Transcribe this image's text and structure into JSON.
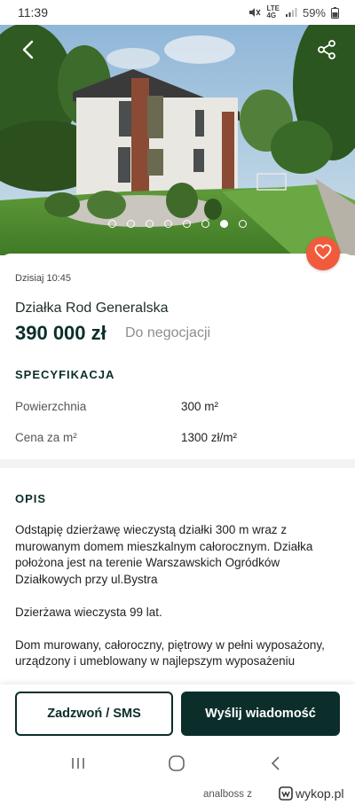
{
  "status_bar": {
    "time": "11:39",
    "network": "LTE",
    "network_sub": "4G",
    "battery": "59%",
    "icons": [
      "mute-icon",
      "signal-icon",
      "battery-icon"
    ]
  },
  "gallery": {
    "photo_count": 8,
    "active_index": 6,
    "icons": [
      "back-arrow-icon",
      "share-icon"
    ]
  },
  "listing": {
    "date": "Dzisiaj 10:45",
    "title": "Działka Rod Generalska",
    "price": "390 000 zł",
    "negotiable": "Do negocjacji",
    "favorite_icon": "heart-icon"
  },
  "specs": {
    "heading": "SPECYFIKACJA",
    "rows": [
      {
        "label": "Powierzchnia",
        "value": "300 m²"
      },
      {
        "label": "Cena za m²",
        "value": "1300 zł/m²"
      }
    ]
  },
  "description": {
    "heading": "OPIS",
    "paragraphs": [
      "Odstąpię dzierżawę wieczystą działki 300 m wraz z murowanym domem mieszkalnym całorocznym. Działka położona jest na terenie Warszawskich Ogródków Działkowych przy ul.Bystra",
      "Dzierżawa wieczysta 99 lat.",
      "Dom murowany, całoroczny, piętrowy w pełni wyposażony, urządzony i umeblowany w najlepszym wyposażeniu"
    ]
  },
  "actions": {
    "call_label": "Zadzwoń / SMS",
    "message_label": "Wyślij wiadomość"
  },
  "navigation": {
    "icons": [
      "recent-apps-icon",
      "home-icon",
      "back-icon"
    ]
  },
  "watermark": {
    "user": "analboss",
    "connector": "z",
    "site": "wykop.pl"
  },
  "colors": {
    "brand_dark": "#0b2e2a",
    "favorite": "#f25a3c"
  }
}
